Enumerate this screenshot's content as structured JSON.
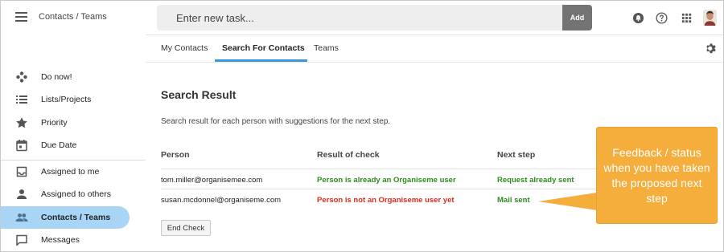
{
  "topbar": {
    "app_title": "Contacts / Teams",
    "task_placeholder": "Enter new task...",
    "add_label": "Add",
    "icons": [
      "notification-icon",
      "help-icon",
      "apps-grid-icon",
      "user-avatar"
    ]
  },
  "sidebar": {
    "items": [
      {
        "label": "Do now!",
        "icon": "do-now-icon"
      },
      {
        "label": "Lists/Projects",
        "icon": "list-icon"
      },
      {
        "label": "Priority",
        "icon": "star-icon"
      },
      {
        "label": "Due Date",
        "icon": "calendar-icon"
      },
      {
        "label": "Assigned to me",
        "icon": "inbox-icon"
      },
      {
        "label": "Assigned to others",
        "icon": "person-icon"
      },
      {
        "label": "Contacts / Teams",
        "icon": "people-icon",
        "active": true
      },
      {
        "label": "Messages",
        "icon": "message-icon"
      }
    ]
  },
  "tabs": [
    {
      "label": "My Contacts"
    },
    {
      "label": "Search For Contacts",
      "active": true
    },
    {
      "label": "Teams"
    }
  ],
  "main": {
    "title": "Search Result",
    "subtitle": "Search result for each person with suggestions for the next step.",
    "columns": [
      "Person",
      "Result of check",
      "Next step"
    ],
    "rows": [
      {
        "person": "tom.miller@organisemee.com",
        "result": "Person is already an Organiseme user",
        "next": "Request already sent"
      },
      {
        "person": "susan.mcdonnel@organiseme.com",
        "result": "Person is not an Organiseme user yet",
        "next": "Mail sent"
      }
    ],
    "end_check_label": "End Check"
  },
  "callout": {
    "text": "Feedback / status when you have taken the proposed next step"
  },
  "colors": {
    "accent": "#3a9ad9",
    "active_nav": "#a8d5f5",
    "success": "#2e8b1f",
    "error": "#e02b1e",
    "callout": "#f5ad3b"
  }
}
